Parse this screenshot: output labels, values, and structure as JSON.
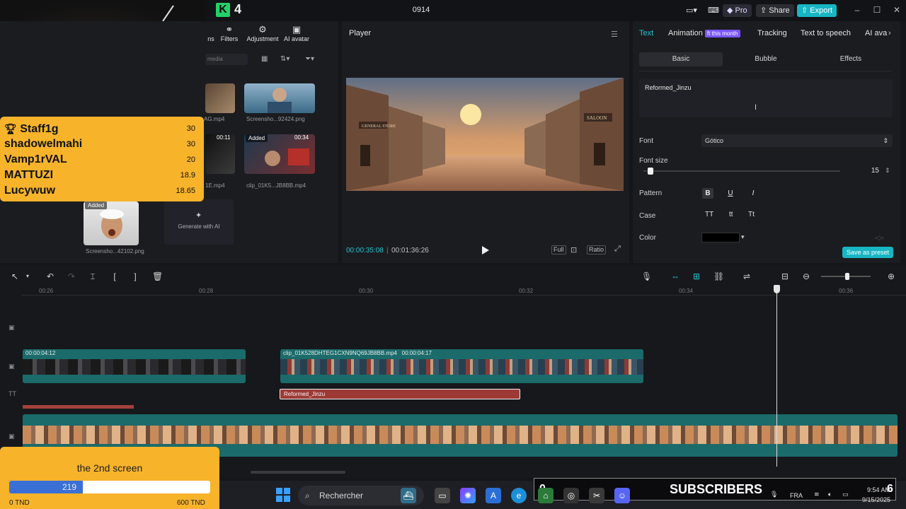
{
  "titlebar": {
    "brand_letter": "K",
    "brand_number": "4",
    "project_title": "0914",
    "pro_label": "Pro",
    "share_label": "Share",
    "export_label": "Export",
    "minimize": "–",
    "maximize": "☐",
    "close": "✕"
  },
  "media": {
    "tabs": [
      {
        "label": "ns",
        "icon": "stickers-icon"
      },
      {
        "label": "Filters",
        "icon": "filters-icon"
      },
      {
        "label": "Adjustment",
        "icon": "adjustment-icon"
      },
      {
        "label": "AI avatar",
        "icon": "ai-avatar-icon"
      }
    ],
    "search_placeholder": "media",
    "items": [
      {
        "name": "AG.mp4"
      },
      {
        "name": "Screensho...92424.png"
      },
      {
        "name": "1E.mp4",
        "duration": "00:11"
      },
      {
        "name": "clip_01K5...JB8BB.mp4",
        "added": "Added",
        "duration": "00:34"
      },
      {
        "name": "Screensho...42102.png",
        "added": "Added"
      }
    ],
    "generate_ai": "Generate with AI"
  },
  "leaderboard": [
    {
      "name": "Staff1g",
      "score": "30"
    },
    {
      "name": "shadowelmahi",
      "score": "30"
    },
    {
      "name": "Vamp1rVAL",
      "score": "20"
    },
    {
      "name": "MATTUZI",
      "score": "18.9"
    },
    {
      "name": "Lucywuw",
      "score": "18.65"
    }
  ],
  "player": {
    "title": "Player",
    "current_time": "00:00:35:08",
    "total_time": "00:01:36:26",
    "full_label": "Full",
    "ratio_label": "Ratio",
    "scene_signs": {
      "left": "GENERAL STORE",
      "right": "SALOON"
    }
  },
  "inspector": {
    "tabs": [
      "Text",
      "Animation",
      "Tracking",
      "Text to speech",
      "AI ava"
    ],
    "animation_badge": "ft this month",
    "subtabs": [
      "Basic",
      "Bubble",
      "Effects"
    ],
    "text_value": "Reformed_Jinzu",
    "font_label": "Font",
    "font_value": "Gótico",
    "font_size_label": "Font size",
    "font_size_value": "15",
    "font_size_fraction": 0.02,
    "pattern_label": "Pattern",
    "pattern_buttons": [
      "B",
      "U",
      "I"
    ],
    "case_label": "Case",
    "case_buttons": [
      "TT",
      "tt",
      "Tt"
    ],
    "color_label": "Color",
    "color_value": "#000000",
    "save_preset": "Save as preset"
  },
  "timeline": {
    "ruler": [
      "00:26",
      "00:28",
      "00:30",
      "00:32",
      "00:34",
      "00:36"
    ],
    "clip1_time": "00:00:04:12",
    "clip2_name": "clip_01K528DHTEG1CXN9NQ69JB8BB.mp4",
    "clip2_time": "00:00:04:17",
    "text_clip": "Reformed_Jinzu",
    "track_text_icon": "TT"
  },
  "goal": {
    "title": "the 2nd screen",
    "current": "219",
    "fraction": 0.365,
    "min_label": "0 TND",
    "max_label": "600 TND"
  },
  "taskbar": {
    "search_label": "Rechercher",
    "language": "FRA",
    "time": "9:54 AM",
    "date": "9/15/2025"
  },
  "subscribers": {
    "count_left": "0",
    "label": "SUBSCRIBERS",
    "count_right": "6"
  },
  "colors": {
    "accent": "#17b6c4",
    "leader_bg": "#f7b32a",
    "text_clip": "#9e3a36"
  }
}
